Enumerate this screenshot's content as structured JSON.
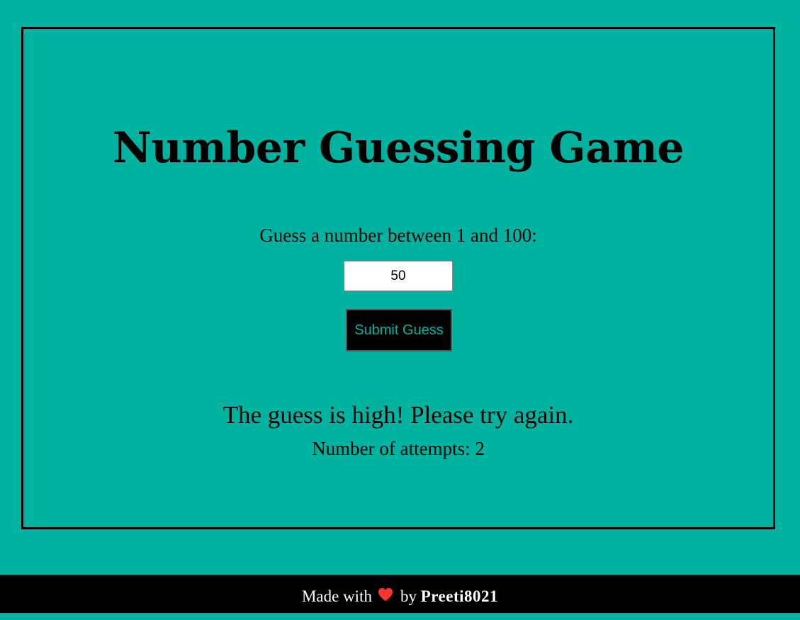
{
  "game": {
    "title": "Number Guessing Game",
    "prompt": "Guess a number between 1 and 100:",
    "guess_value": "50",
    "submit_label": "Submit Guess",
    "feedback": "The guess is high! Please try again.",
    "attempts_text": "Number of attempts: 2"
  },
  "footer": {
    "made_with": "Made with",
    "heart_icon": "heart-icon",
    "heart_color": "#ff3333",
    "by": "by",
    "author": "Preeti8021"
  },
  "colors": {
    "background": "#00b3a0",
    "button_bg": "#000000",
    "button_text": "#00b3a0",
    "footer_bg": "#000000"
  }
}
